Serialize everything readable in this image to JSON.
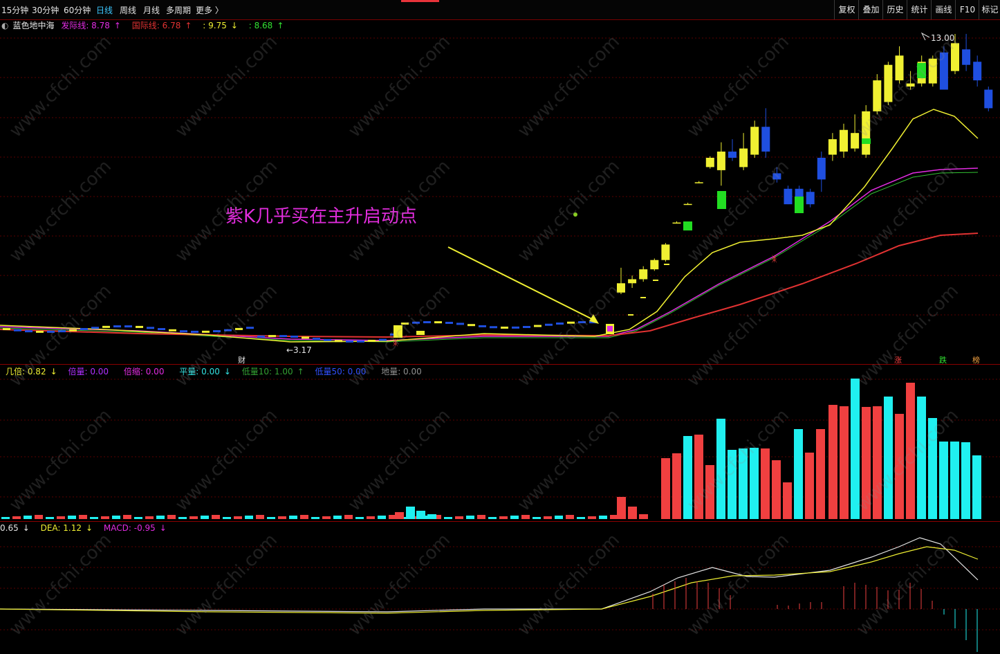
{
  "toolbar": {
    "periods": [
      "15分钟",
      "30分钟",
      "60分钟",
      "日线",
      "周线",
      "月线",
      "多周期",
      "更多 〉"
    ],
    "active_period": "日线",
    "right_buttons": [
      "复权",
      "叠加",
      "历史",
      "统计",
      "画线",
      "F10",
      "标记"
    ]
  },
  "main_panel": {
    "indicator_name": "蓝色地中海",
    "lines": [
      {
        "label": "发际线: 8.78",
        "arrow": "↑",
        "color": "#e22ce2"
      },
      {
        "label": "国际线: 6.78",
        "arrow": "↑",
        "color": "#e23232"
      },
      {
        "label": ": 9.75",
        "arrow": "↓",
        "color": "#f0f032"
      },
      {
        "label": ": 8.68",
        "arrow": "↑",
        "color": "#32e232"
      }
    ],
    "high_label": "13.00",
    "low_label": "←3.17",
    "annotation": "紫K几乎买在主升启动点",
    "marker_cai": "财",
    "marker_zhang": "涨",
    "marker_die": "跌",
    "marker_bang": "榜"
  },
  "volume_panel": {
    "labels": [
      {
        "label": "几倍: 0.82",
        "arrow": "↓",
        "color": "#f0f032"
      },
      {
        "label": "倍量: 0.00",
        "arrow": "",
        "color": "#b030ff"
      },
      {
        "label": "倍缩: 0.00",
        "arrow": "",
        "color": "#e22ce2"
      },
      {
        "label": "平量: 0.00",
        "arrow": "↓",
        "color": "#32e2e2"
      },
      {
        "label": "低量10: 1.00",
        "arrow": "↑",
        "color": "#32a032"
      },
      {
        "label": "低量50: 0.00",
        "arrow": "",
        "color": "#3050ff"
      },
      {
        "label": "地量: 0.00",
        "arrow": "",
        "color": "#909090"
      }
    ]
  },
  "macd_panel": {
    "labels": [
      {
        "label": "0.65",
        "arrow": "↓",
        "color": "#e6e6e6"
      },
      {
        "label": "DEA: 1.12",
        "arrow": "↓",
        "color": "#f0f032"
      },
      {
        "label": "MACD: -0.95",
        "arrow": "↓",
        "color": "#e22ce2"
      }
    ]
  },
  "watermark_text": "www.cfchi.com",
  "colors": {
    "up": "#f0f032",
    "down": "#1f4fe0",
    "purple": "#e22ce2",
    "red": "#e23232",
    "volume_red": "#f04040",
    "volume_cyan": "#20f0f0"
  },
  "price_data": {
    "ylim": [
      3,
      13.5
    ],
    "candles": [
      {
        "o": 4.95,
        "c": 5.25,
        "h": 5.75,
        "l": 4.9
      },
      {
        "o": 5.25,
        "c": 5.38,
        "h": 5.5,
        "l": 5.1
      },
      {
        "o": 5.38,
        "c": 5.7,
        "h": 5.8,
        "l": 5.3
      },
      {
        "o": 5.7,
        "c": 6.0,
        "h": 6.05,
        "l": 5.65
      },
      {
        "o": 6.0,
        "c": 6.5,
        "h": 6.55,
        "l": 5.95
      },
      {
        "o": 7.2,
        "c": 7.21,
        "h": 7.25,
        "l": 7.18
      },
      {
        "o": 7.8,
        "c": 7.81,
        "h": 7.85,
        "l": 7.78
      },
      {
        "o": 8.5,
        "c": 8.51,
        "h": 8.55,
        "l": 8.48
      },
      {
        "o": 9.0,
        "c": 9.3,
        "h": 9.35,
        "l": 8.95
      },
      {
        "o": 8.9,
        "c": 9.5,
        "h": 9.8,
        "l": 8.4
      },
      {
        "o": 9.5,
        "c": 9.3,
        "h": 9.9,
        "l": 9.2
      },
      {
        "o": 9.0,
        "c": 9.6,
        "h": 10.1,
        "l": 8.9
      },
      {
        "o": 9.4,
        "c": 10.3,
        "h": 10.5,
        "l": 9.3
      },
      {
        "o": 10.3,
        "c": 9.5,
        "h": 10.9,
        "l": 9.3
      },
      {
        "o": 8.8,
        "c": 8.6,
        "h": 9.0,
        "l": 8.5
      },
      {
        "o": 8.3,
        "c": 7.8,
        "h": 8.4,
        "l": 7.8
      },
      {
        "o": 8.3,
        "c": 7.8,
        "h": 8.4,
        "l": 7.8
      },
      {
        "o": 8.2,
        "c": 7.8,
        "h": 8.3,
        "l": 7.7
      },
      {
        "o": 9.3,
        "c": 8.6,
        "h": 9.5,
        "l": 8.2
      },
      {
        "o": 9.4,
        "c": 9.9,
        "h": 10.1,
        "l": 9.2
      },
      {
        "o": 9.5,
        "c": 10.2,
        "h": 10.4,
        "l": 9.3
      },
      {
        "o": 9.6,
        "c": 10.1,
        "h": 10.7,
        "l": 9.5
      },
      {
        "o": 9.4,
        "c": 10.8,
        "h": 11.0,
        "l": 9.3
      },
      {
        "o": 10.8,
        "c": 11.8,
        "h": 12.0,
        "l": 10.7
      },
      {
        "o": 11.1,
        "c": 12.3,
        "h": 12.4,
        "l": 11.0
      },
      {
        "o": 11.8,
        "c": 12.6,
        "h": 12.9,
        "l": 11.7
      },
      {
        "o": 11.6,
        "c": 11.7,
        "h": 12.1,
        "l": 11.5
      },
      {
        "o": 11.7,
        "c": 12.4,
        "h": 12.6,
        "l": 11.6
      },
      {
        "o": 11.7,
        "c": 12.5,
        "h": 12.6,
        "l": 11.6
      },
      {
        "o": 12.7,
        "c": 11.5,
        "h": 12.9,
        "l": 11.5
      },
      {
        "o": 12.1,
        "c": 13.0,
        "h": 13.3,
        "l": 12.0
      },
      {
        "o": 12.8,
        "c": 12.3,
        "h": 13.3,
        "l": 12.1
      },
      {
        "o": 12.4,
        "c": 11.8,
        "h": 12.6,
        "l": 11.6
      },
      {
        "o": 11.5,
        "c": 10.9,
        "h": 11.6,
        "l": 10.8
      }
    ]
  }
}
